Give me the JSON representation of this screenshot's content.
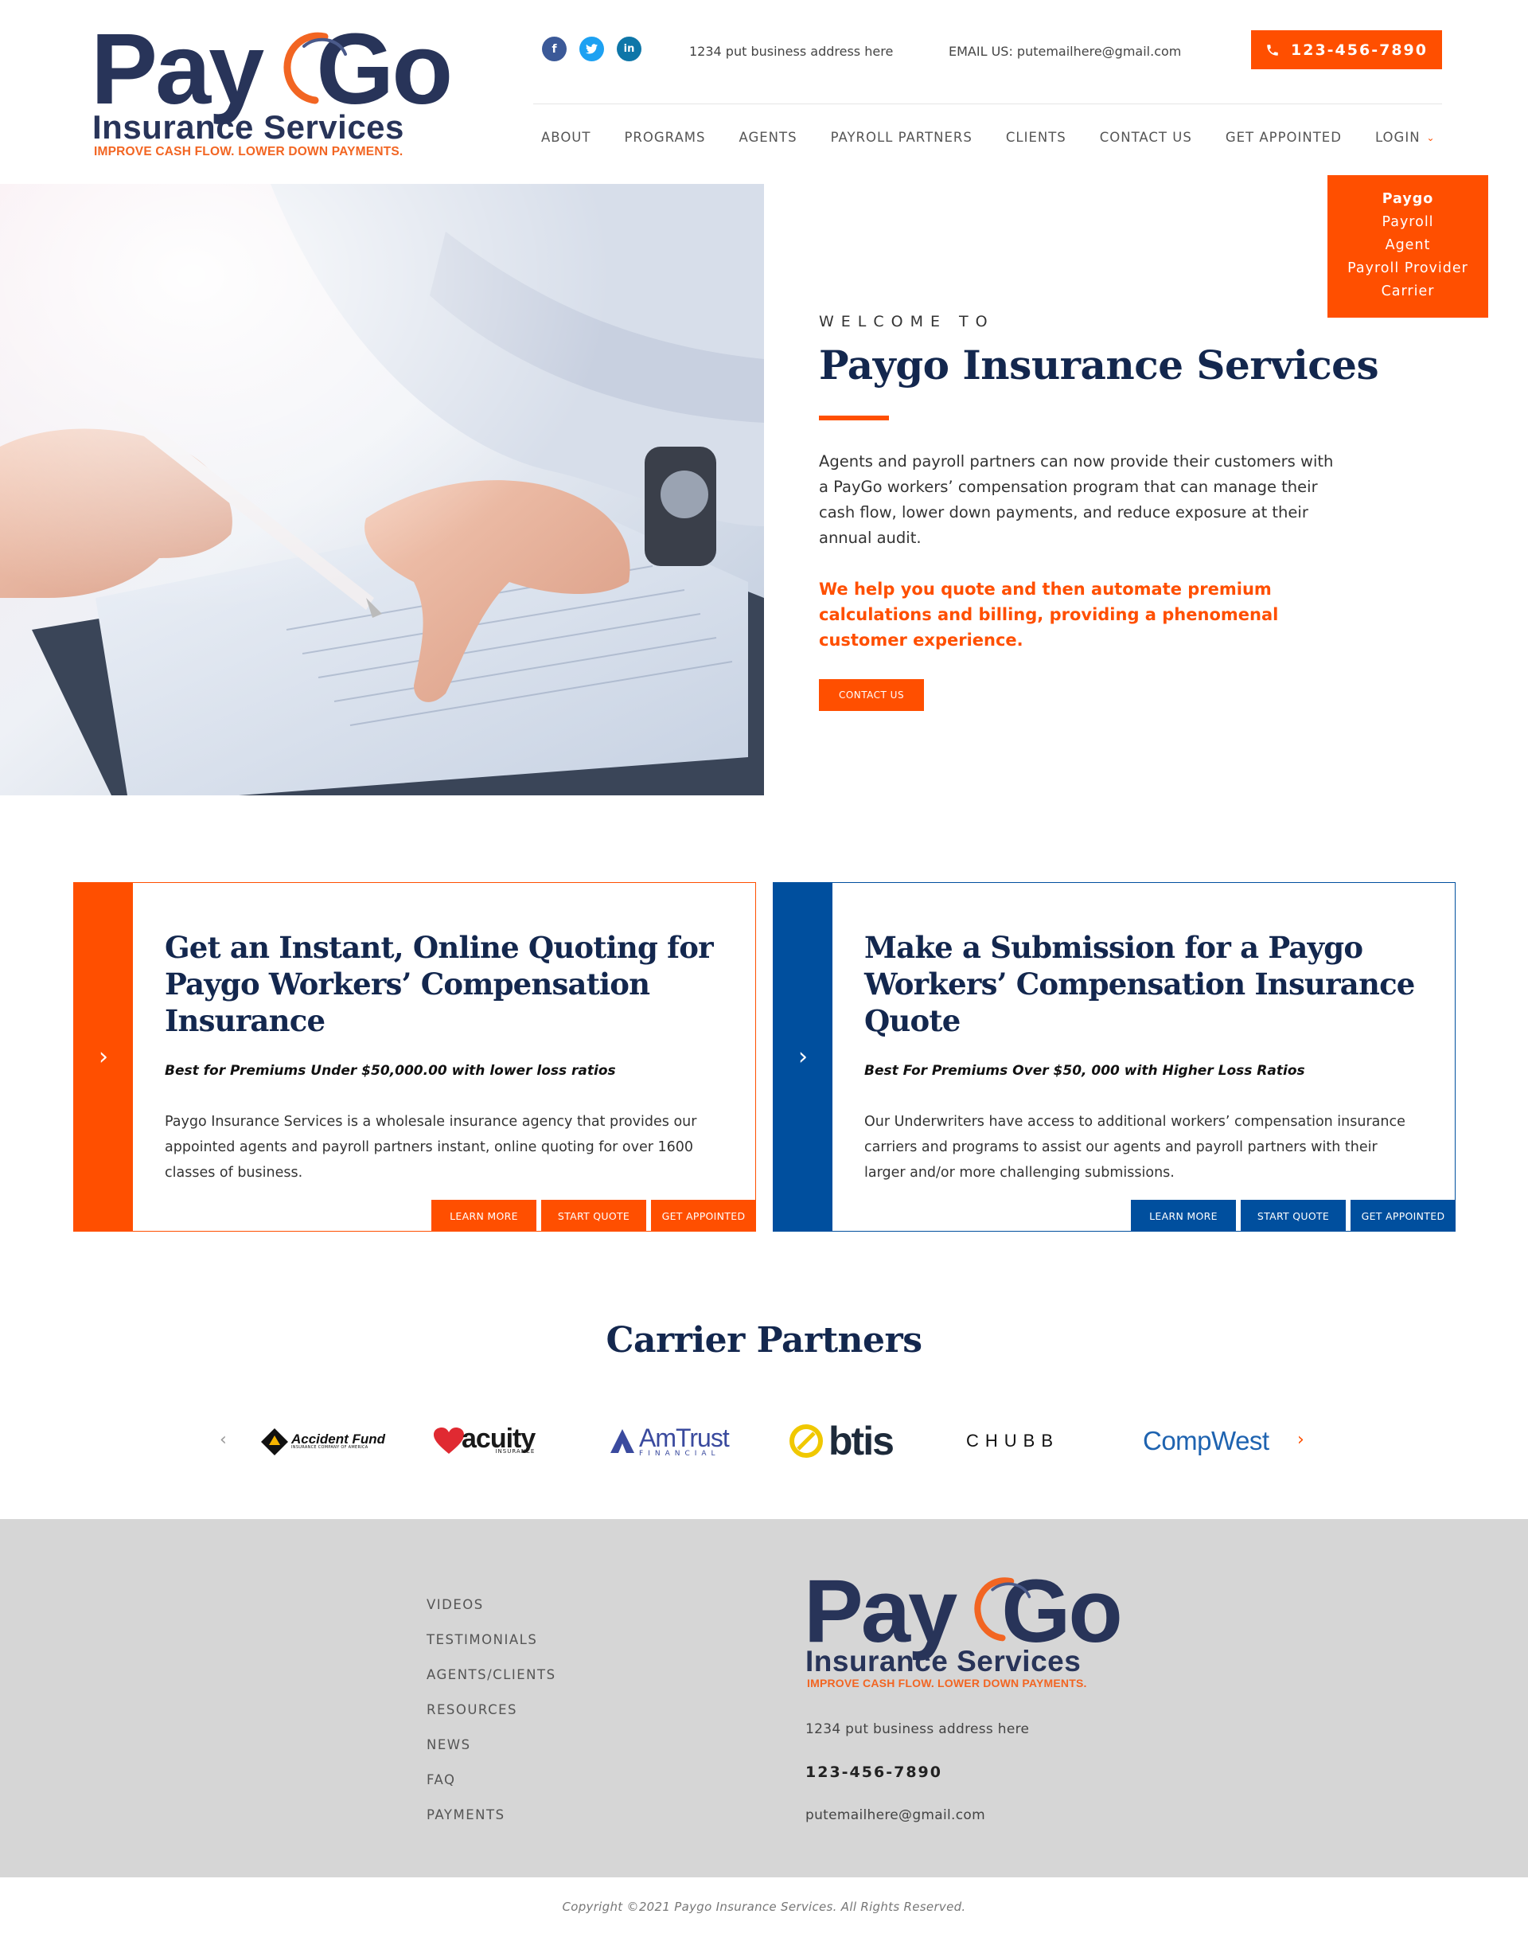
{
  "brand": {
    "word_left": "Pay",
    "word_right": "Go",
    "sub": "Insurance Services",
    "tagline": "IMPROVE CASH FLOW. LOWER DOWN PAYMENTS.",
    "colors": {
      "navy": "#283459",
      "orange": "#f26522",
      "accent": "#ff4f00",
      "blue": "#004f9e"
    }
  },
  "header": {
    "socials": [
      {
        "icon": "facebook-icon",
        "glyph": "f"
      },
      {
        "icon": "twitter-icon",
        "glyph": "t"
      },
      {
        "icon": "linkedin-icon",
        "glyph": "in"
      }
    ],
    "address": "1234 put business address here",
    "email": "EMAIL US: putemailhere@gmail.com",
    "phone": "123-456-7890"
  },
  "nav": {
    "items": [
      "ABOUT",
      "PROGRAMS",
      "AGENTS",
      "PAYROLL PARTNERS",
      "CLIENTS",
      "CONTACT US",
      "GET APPOINTED"
    ],
    "login": "LOGIN",
    "login_menu": [
      "Paygo",
      "Payroll",
      "Agent",
      "Payroll Provider",
      "Carrier"
    ]
  },
  "hero": {
    "welcome": "WELCOME TO",
    "title": "Paygo Insurance Services",
    "body": "Agents and payroll partners can now provide their customers with a PayGo workers’ compensation program that can manage their cash flow, lower down payments, and reduce exposure at their annual audit.",
    "highlight": "We help you quote and then automate premium calculations and billing, providing a phenomenal customer experience.",
    "button": "CONTACT US"
  },
  "cards": [
    {
      "title": "Get an Instant, Online Quoting for Paygo Workers’ Compensation Insurance",
      "subtitle": "Best for Premiums Under $50,000.00 with lower loss ratios",
      "body": "Paygo Insurance Services is a wholesale insurance agency that provides our appointed agents and payroll partners instant, online quoting for over 1600 classes of business.",
      "buttons": [
        "LEARN MORE",
        "START QUOTE",
        "GET APPOINTED"
      ]
    },
    {
      "title": "Make a Submission for a Paygo Workers’ Compensation Insurance Quote",
      "subtitle": "Best For Premiums Over $50, 000 with Higher Loss Ratios",
      "body": "Our Underwriters have access to additional workers’ compensation insurance carriers and programs to assist our agents and payroll partners with their larger and/or more challenging submissions.",
      "buttons": [
        "LEARN MORE",
        "START QUOTE",
        "GET APPOINTED"
      ]
    }
  ],
  "carriers": {
    "title": "Carrier Partners",
    "logos": [
      {
        "name": "Accident Fund",
        "small": "INSURANCE COMPANY OF AMERICA"
      },
      {
        "name": "acuity",
        "small": "INSURANCE"
      },
      {
        "name": "AmTrust",
        "small": "FINANCIAL"
      },
      {
        "name": "btis"
      },
      {
        "name": "CHUBB"
      },
      {
        "name": "CompWest"
      }
    ]
  },
  "footer": {
    "links": [
      "VIDEOS",
      "TESTIMONIALS",
      "AGENTS/CLIENTS",
      "RESOURCES",
      "NEWS",
      "FAQ",
      "PAYMENTS"
    ],
    "address": "1234 put business address here",
    "phone": "123-456-7890",
    "email": "putemailhere@gmail.com",
    "copyright": "Copyright ©2021 Paygo Insurance Services. All Rights Reserved."
  }
}
